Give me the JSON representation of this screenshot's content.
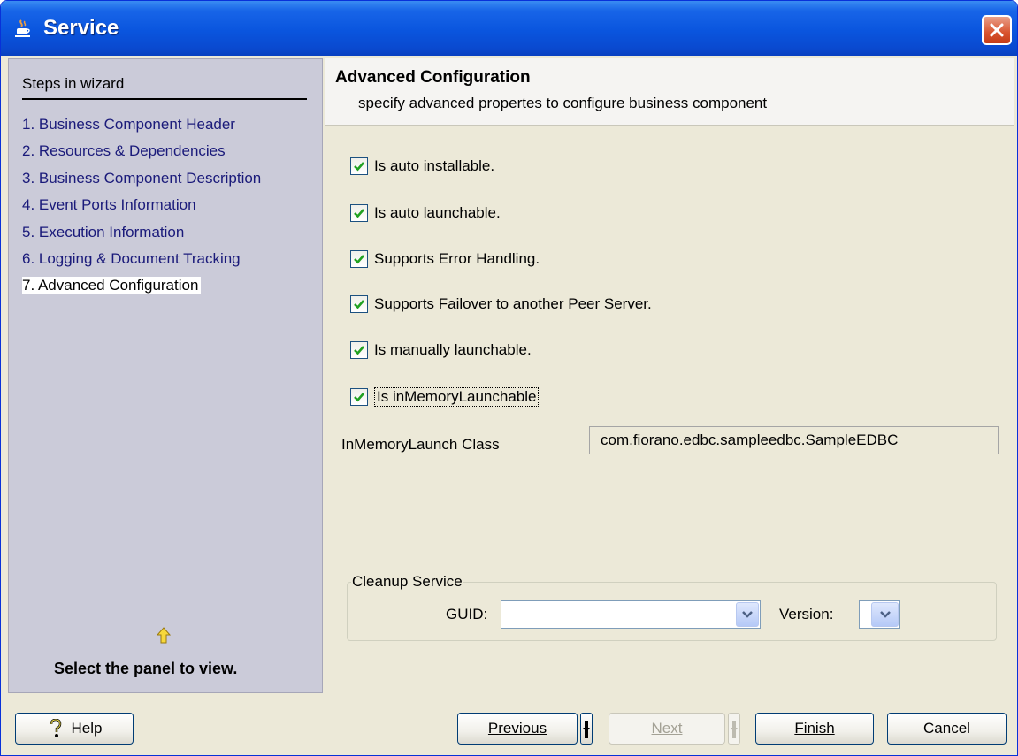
{
  "window": {
    "title": "Service"
  },
  "sidebar": {
    "header": "Steps in wizard",
    "steps": [
      {
        "label": "1. Business Component Header",
        "active": false
      },
      {
        "label": "2. Resources & Dependencies",
        "active": false
      },
      {
        "label": "3. Business Component Description",
        "active": false
      },
      {
        "label": "4. Event Ports Information",
        "active": false
      },
      {
        "label": "5. Execution Information",
        "active": false
      },
      {
        "label": "6. Logging & Document Tracking",
        "active": false
      },
      {
        "label": "7. Advanced Configuration",
        "active": true
      }
    ],
    "hint": "Select the panel to view."
  },
  "main": {
    "title": "Advanced Configuration",
    "subtitle": "specify advanced propertes to configure business component",
    "options": [
      {
        "label": "Is auto installable.",
        "checked": true
      },
      {
        "label": "Is auto launchable.",
        "checked": true
      },
      {
        "label": "Supports Error Handling.",
        "checked": true
      },
      {
        "label": "Supports Failover to another Peer Server.",
        "checked": true
      },
      {
        "label": "Is manually launchable.",
        "checked": true
      },
      {
        "label": "Is inMemoryLaunchable",
        "checked": true
      }
    ],
    "launch_class": {
      "label": "InMemoryLaunch Class",
      "value": "com.fiorano.edbc.sampleedbc.SampleEDBC"
    },
    "cleanup": {
      "legend": "Cleanup Service",
      "guid_label": "GUID:",
      "guid_value": "",
      "version_label": "Version:",
      "version_value": ""
    }
  },
  "buttons": {
    "help": "Help",
    "previous": "Previous",
    "next": "Next",
    "finish": "Finish",
    "cancel": "Cancel"
  }
}
